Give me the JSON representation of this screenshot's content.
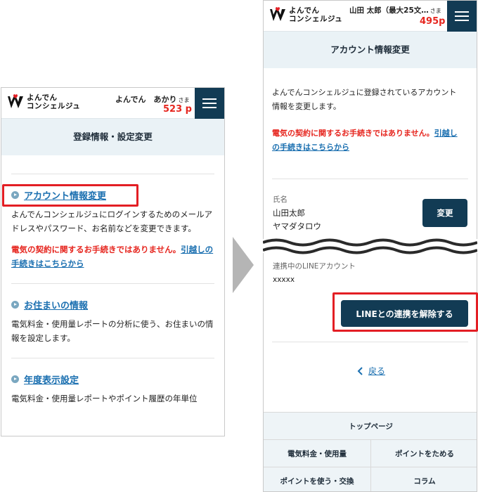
{
  "left": {
    "logo": {
      "line1": "よんでん",
      "line2": "コンシェルジュ"
    },
    "user": {
      "name": "よんでん　あかり",
      "honorific": "さま",
      "points": "523 p"
    },
    "title": "登録情報・設定変更",
    "sections": [
      {
        "link": "アカウント情報変更",
        "desc": "よんでんコンシェルジュにログインするためのメールアドレスやパスワード、お名前などを変更できます。",
        "warn": "電気の契約に関するお手続きではありません。",
        "warn_link": "引越しの手続きはこちらから"
      },
      {
        "link": "お住まいの情報",
        "desc": "電気料金・使用量レポートの分析に使う、お住まいの情報を設定します。"
      },
      {
        "link": "年度表示設定",
        "desc": "電気料金・使用量レポートやポイント履歴の年単位"
      }
    ]
  },
  "right": {
    "logo": {
      "line1": "よんでん",
      "line2": "コンシェルジュ"
    },
    "user": {
      "name": "山田 太郎（最大25文…",
      "honorific": "さま",
      "points": "495p"
    },
    "title": "アカウント情報変更",
    "intro": "よんでんコンシェルジュに登録されているアカウント情報を変更します。",
    "warn": "電気の契約に関するお手続きではありません。",
    "warn_link": "引越しの手続きはこちらから",
    "name_label": "氏名",
    "name_value": "山田太郎",
    "name_kana": "ヤマダタロウ",
    "change_button": "変更",
    "line_label": "連携中のLINEアカウント",
    "line_value": "xxxxx",
    "unlink_button": "LINEとの連携を解除する",
    "back_link": "戻る",
    "footer": {
      "top": "トップページ",
      "rows": [
        [
          "電気料金・使用量",
          "ポイントをためる"
        ],
        [
          "ポイントを使う・交換",
          "コラム"
        ]
      ]
    }
  },
  "colors": {
    "navy": "#123b54",
    "red": "#e31e24",
    "link": "#1a6fb0",
    "title_bg": "#eaf2f6"
  }
}
